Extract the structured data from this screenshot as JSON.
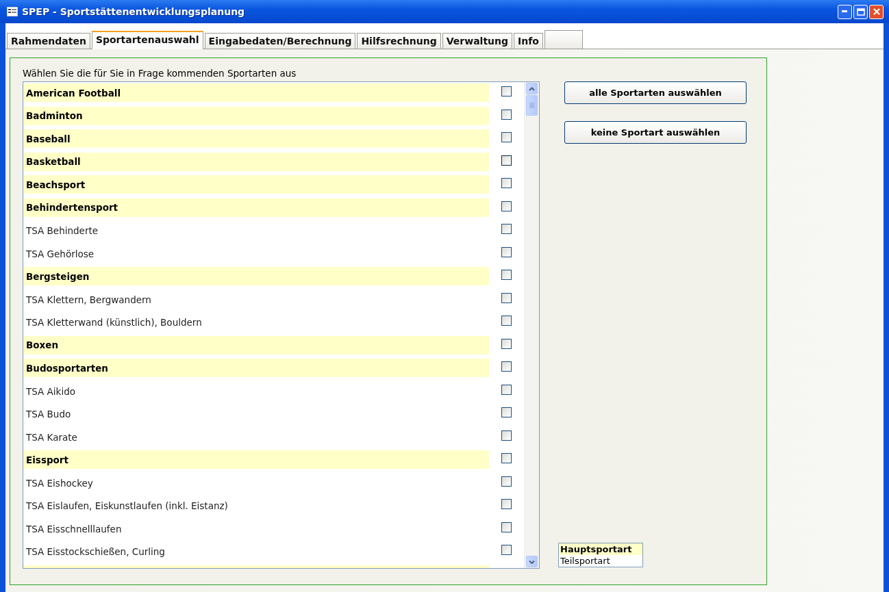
{
  "window": {
    "title": "SPEP - Sportstättenentwicklungsplanung"
  },
  "tabs": [
    {
      "label": "Rahmendaten",
      "selected": false
    },
    {
      "label": "Sportartenauswahl",
      "selected": true
    },
    {
      "label": "Eingabedaten/Berechnung",
      "selected": false
    },
    {
      "label": "Hilfsrechnung",
      "selected": false
    },
    {
      "label": "Verwaltung",
      "selected": false
    },
    {
      "label": "Info",
      "selected": false
    }
  ],
  "instruction": "Wählen Sie die für Sie in Frage kommenden Sportarten aus",
  "sports": [
    {
      "label": "American Football",
      "kind": "main",
      "checked": false,
      "focused": false
    },
    {
      "label": "Badminton",
      "kind": "main",
      "checked": false,
      "focused": false
    },
    {
      "label": "Baseball",
      "kind": "main",
      "checked": false,
      "focused": false
    },
    {
      "label": "Basketball",
      "kind": "main",
      "checked": false,
      "focused": true
    },
    {
      "label": "Beachsport",
      "kind": "main",
      "checked": false,
      "focused": false
    },
    {
      "label": "Behindertensport",
      "kind": "main",
      "checked": false,
      "focused": false
    },
    {
      "label": "TSA Behinderte",
      "kind": "sub",
      "checked": false,
      "focused": false
    },
    {
      "label": "TSA Gehörlose",
      "kind": "sub",
      "checked": false,
      "focused": false
    },
    {
      "label": "Bergsteigen",
      "kind": "main",
      "checked": false,
      "focused": false
    },
    {
      "label": "TSA Klettern, Bergwandern",
      "kind": "sub",
      "checked": false,
      "focused": false
    },
    {
      "label": "TSA Kletterwand (künstlich), Bouldern",
      "kind": "sub",
      "checked": false,
      "focused": false
    },
    {
      "label": "Boxen",
      "kind": "main",
      "checked": false,
      "focused": false
    },
    {
      "label": "Budosportarten",
      "kind": "main",
      "checked": false,
      "focused": false
    },
    {
      "label": "TSA Aikido",
      "kind": "sub",
      "checked": false,
      "focused": false
    },
    {
      "label": "TSA Budo",
      "kind": "sub",
      "checked": false,
      "focused": false
    },
    {
      "label": "TSA Karate",
      "kind": "sub",
      "checked": false,
      "focused": false
    },
    {
      "label": "Eissport",
      "kind": "main",
      "checked": false,
      "focused": false
    },
    {
      "label": "TSA Eishockey",
      "kind": "sub",
      "checked": false,
      "focused": false
    },
    {
      "label": "TSA Eislaufen, Eiskunstlaufen (inkl. Eistanz)",
      "kind": "sub",
      "checked": false,
      "focused": false
    },
    {
      "label": "TSA Eisschnelllaufen",
      "kind": "sub",
      "checked": false,
      "focused": false
    },
    {
      "label": "TSA Eisstockschießen, Curling",
      "kind": "sub",
      "checked": false,
      "focused": false
    },
    {
      "kind": "main"
    }
  ],
  "buttons": [
    "alle Sportarten auswählen",
    "keine Sportart auswählen"
  ],
  "legend": [
    {
      "label": "Hauptsportart",
      "kind": "main"
    },
    {
      "label": "Teilsportart",
      "kind": "sub"
    }
  ]
}
